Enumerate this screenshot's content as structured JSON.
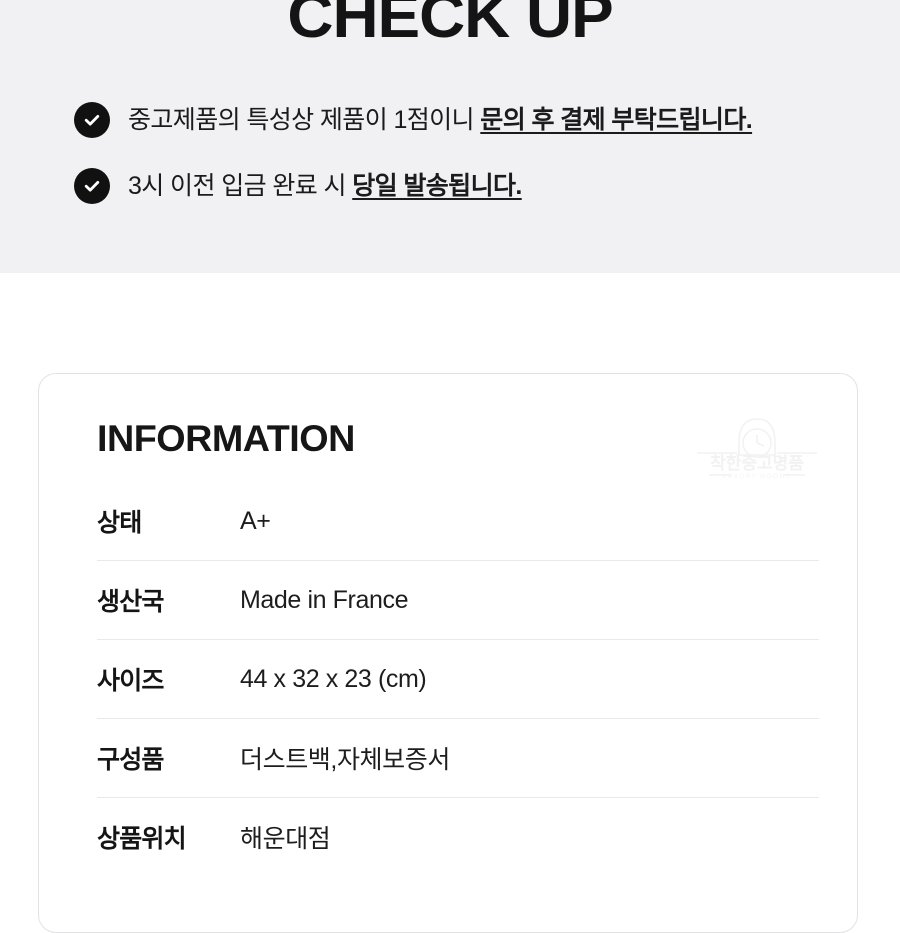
{
  "banner": {
    "title": "CHECK UP",
    "bullets": [
      {
        "icon": "check-circle-icon",
        "plain_before": "중고제품의 특성상 제품이 1점이니 ",
        "emphasis": "문의 후 결제 부탁드립니다."
      },
      {
        "icon": "check-circle-icon",
        "plain_before": "3시 이전 입금 완료 시 ",
        "emphasis": "당일 발송됩니다."
      }
    ]
  },
  "card": {
    "heading": "INFORMATION",
    "watermark": {
      "brand": "착한중고명품",
      "tagline": "LUXURY GOODS"
    },
    "rows": [
      {
        "label": "상태",
        "value": "A+"
      },
      {
        "label": "생산국",
        "value": "Made in France"
      },
      {
        "label": "사이즈",
        "value": "44 x 32 x 23 (cm)"
      },
      {
        "label": "구성품",
        "value": "더스트백,자체보증서"
      },
      {
        "label": "상품위치",
        "value": "해운대점"
      }
    ]
  },
  "colors": {
    "banner_bg": "#f1f1f3",
    "page_bg": "#ffffff",
    "text": "#151515",
    "bullet_icon_bg": "#111111",
    "bullet_icon_fg": "#ffffff",
    "card_border": "#e2e2e4",
    "divider": "#e9e9eb",
    "watermark": "#f3f3f4"
  }
}
